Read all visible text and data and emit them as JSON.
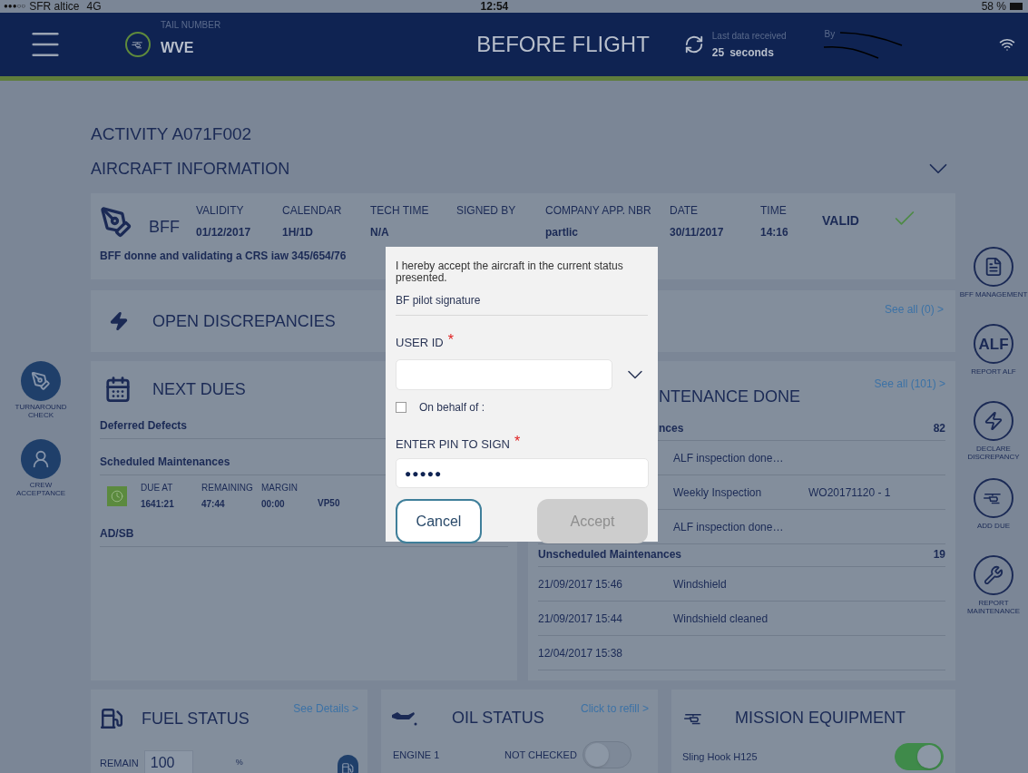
{
  "status_bar": {
    "signal": "●●●○○",
    "carrier": "SFR altice",
    "network": "4G",
    "time": "12:54",
    "battery": "58 %"
  },
  "header": {
    "tail_label": "TAIL NUMBER",
    "tail_number": "WVE",
    "title": "BEFORE FLIGHT",
    "sync_label": "Last data received",
    "sync_value": "25",
    "sync_unit": "seconds",
    "by_label": "By"
  },
  "left_rail": [
    {
      "kind": "pen",
      "label": "TURNAROUND CHECK"
    },
    {
      "kind": "person",
      "label": "CREW ACCEPTANCE"
    }
  ],
  "right_rail": [
    {
      "kind": "document",
      "label": "BFF MANAGEMENT"
    },
    {
      "kind": "alf",
      "glyph": "ALF",
      "label": "REPORT ALF"
    },
    {
      "kind": "bolt",
      "label": "DECLARE DISCREPANCY"
    },
    {
      "kind": "helicopter",
      "label": "ADD DUE"
    },
    {
      "kind": "tools",
      "label": "REPORT MAINTENANCE"
    }
  ],
  "activity": "ACTIVITY A071F002",
  "aircraft_information": {
    "title": "AIRCRAFT INFORMATION"
  },
  "bff": {
    "title": "BFF",
    "fields": [
      {
        "label": "VALIDITY",
        "value": "01/12/2017"
      },
      {
        "label": "CALENDAR",
        "value": "1H/1D"
      },
      {
        "label": "TECH TIME",
        "value": "N/A"
      },
      {
        "label": "SIGNED BY"
      },
      {
        "label": "COMPANY APP. NBR",
        "value": "partlic"
      },
      {
        "label": "DATE",
        "value": "30/11/2017"
      },
      {
        "label": "TIME",
        "value": "14:16"
      }
    ],
    "status": "VALID",
    "remark": "BFF donne and validating a CRS iaw 345/654/76"
  },
  "open_discrepancies": {
    "title": "OPEN DISCREPANCIES",
    "link": "See all (0) >"
  },
  "next_dues": {
    "title": "NEXT DUES",
    "sections": [
      {
        "title": "Deferred Defects"
      },
      {
        "title": "Scheduled Maintenances",
        "items": [
          {
            "columns": [
              {
                "label": "DUE AT",
                "value": "1641:21"
              },
              {
                "label": "REMAINING",
                "value": "47:44"
              },
              {
                "label": "MARGIN",
                "value": "00:00"
              },
              {
                "value": "VP50"
              }
            ]
          }
        ]
      },
      {
        "title": "AD/SB"
      }
    ]
  },
  "maintenance_done": {
    "title": "NTENANCE DONE",
    "link": "See all (101) >",
    "sections": [
      {
        "title": "nces",
        "count": "82",
        "rows": [
          {
            "description": "ALF inspection done…"
          },
          {
            "description": "Weekly Inspection",
            "reference": "WO20171120 - 1"
          },
          {
            "description": "ALF inspection done…"
          }
        ]
      },
      {
        "title": "Unscheduled Maintenances",
        "count": "19",
        "rows": [
          {
            "date": "21/09/2017",
            "time": "15:46",
            "description": "Windshield"
          },
          {
            "date": "21/09/2017",
            "time": "15:44",
            "description": "Windshield cleaned"
          },
          {
            "date": "12/04/2017",
            "time": "15:38"
          }
        ]
      }
    ]
  },
  "fuel_status": {
    "title": "FUEL STATUS",
    "link": "See Details >",
    "remain_label": "REMAIN",
    "remain_value": "100",
    "unit": "%"
  },
  "oil_status": {
    "title": "OIL STATUS",
    "link": "Click to refill >",
    "engines": [
      {
        "name": "ENGINE 1",
        "status": "NOT CHECKED",
        "on": false
      }
    ]
  },
  "mission_equipment": {
    "title": "MISSION EQUIPMENT",
    "items": [
      {
        "name": "Sling Hook H125",
        "on": true
      }
    ]
  },
  "signature_dialog": {
    "statement": "I hereby accept the aircraft in the current status presented.",
    "role": "BF pilot signature",
    "user_id": {
      "label": "USER ID",
      "required_mark": "*"
    },
    "on_behalf": {
      "label": "On behalf of :",
      "checked": false
    },
    "pin": {
      "label": "ENTER PIN TO SIGN",
      "required_mark": "*",
      "value": "●●●●●"
    },
    "buttons": [
      {
        "label": "Cancel",
        "disabled": false
      },
      {
        "label": "Accept",
        "disabled": true
      }
    ]
  }
}
